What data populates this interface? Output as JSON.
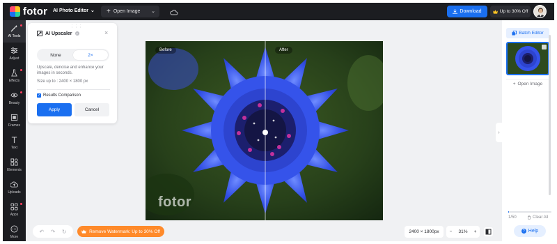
{
  "app": {
    "logo_text": "fotor",
    "product_name": "AI Photo Editor",
    "open_image_label": "Open Image",
    "download_label": "Download",
    "upgrade_label": "Up to 30% Off"
  },
  "rail": {
    "items": [
      {
        "label": "AI Tools",
        "icon": "magic-wand-icon",
        "active": true,
        "badge": true
      },
      {
        "label": "Adjust",
        "icon": "sliders-icon",
        "badge": false
      },
      {
        "label": "Effects",
        "icon": "flask-icon",
        "badge": true
      },
      {
        "label": "Beauty",
        "icon": "eye-icon",
        "badge": true
      },
      {
        "label": "Frames",
        "icon": "frame-icon",
        "badge": false
      },
      {
        "label": "Text",
        "icon": "text-icon",
        "badge": false
      },
      {
        "label": "Elements",
        "icon": "shapes-icon",
        "badge": false
      },
      {
        "label": "Uploads",
        "icon": "cloud-upload-icon",
        "badge": false
      },
      {
        "label": "Apps",
        "icon": "apps-icon",
        "badge": true
      },
      {
        "label": "More",
        "icon": "more-icon",
        "badge": false
      }
    ]
  },
  "panel": {
    "title": "AI Upscaler",
    "options": [
      "None",
      "2×"
    ],
    "selected_option": "2×",
    "description": "Upscale, denoise and enhance your images in seconds.",
    "size_limit": "Size up to : 2400 × 1800 px",
    "compare_label": "Results Comparison",
    "compare_checked": true,
    "apply_label": "Apply",
    "cancel_label": "Cancel"
  },
  "canvas": {
    "before_label": "Before",
    "after_label": "After",
    "watermark": "fotor"
  },
  "right_panel": {
    "batch_label": "Batch Editor",
    "open_image_label": "Open Image",
    "count": "1/50",
    "progress": 0.02,
    "clear_label": "Clear All",
    "help_label": "Help"
  },
  "bottom": {
    "remove_watermark_label": "Remove Watermark: Up to 30% Off",
    "dimensions": "2400 × 1800px",
    "zoom": "31%"
  },
  "colors": {
    "accent": "#1a6ff0",
    "orange": "#ff8a2a",
    "dark": "#1c1d21"
  }
}
